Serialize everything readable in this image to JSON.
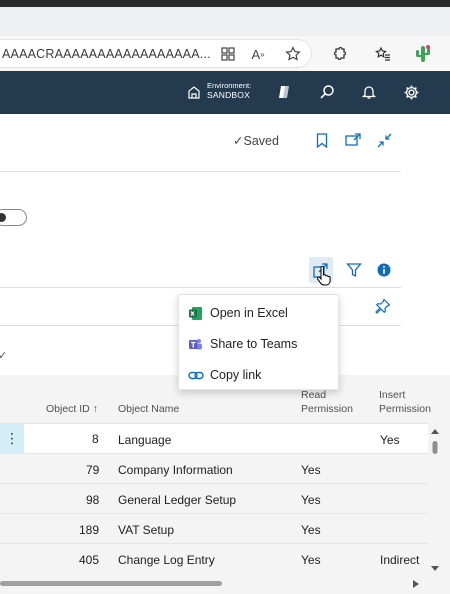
{
  "browser": {
    "url_text": "AAAACRAAAAAAAAAAAAAAAAA...",
    "icons": [
      "grid-icon",
      "read-aloud-icon",
      "favorite-star-icon",
      "extensions-icon",
      "favorites-icon",
      "profile-cactus-icon"
    ]
  },
  "header": {
    "environment_label": "Environment:",
    "environment_value": "SANDBOX",
    "icons": [
      "environment-icon",
      "copilot-icon",
      "search-icon",
      "bell-icon",
      "gear-icon"
    ]
  },
  "page": {
    "saved_check": "✓",
    "saved_label": "Saved",
    "check_mark": "✓"
  },
  "share_menu": {
    "items": [
      {
        "label": "Open in Excel",
        "icon": "excel-icon"
      },
      {
        "label": "Share to Teams",
        "icon": "teams-icon"
      },
      {
        "label": "Copy link",
        "icon": "link-icon"
      }
    ]
  },
  "grid": {
    "columns": {
      "object_id": "Object ID ↑",
      "object_name": "Object Name",
      "read_1": "Read",
      "read_2": "Permission",
      "insert_1": "Insert",
      "insert_2": "Permission"
    },
    "rows": [
      {
        "id": "8",
        "name": "Language",
        "read": "",
        "insert": "Yes"
      },
      {
        "id": "79",
        "name": "Company Information",
        "read": "Yes",
        "insert": ""
      },
      {
        "id": "98",
        "name": "General Ledger Setup",
        "read": "Yes",
        "insert": ""
      },
      {
        "id": "189",
        "name": "VAT Setup",
        "read": "Yes",
        "insert": ""
      },
      {
        "id": "405",
        "name": "Change Log Entry",
        "read": "Yes",
        "insert": "Indirect"
      }
    ],
    "row_menu_glyph": "⋮"
  },
  "colors": {
    "app_header": "#243a4f",
    "selected_row_accent": "#d5edf6",
    "excel_green": "#1f7244",
    "teams_purple": "#5b5fc7",
    "info_blue": "#0f6cbd"
  }
}
